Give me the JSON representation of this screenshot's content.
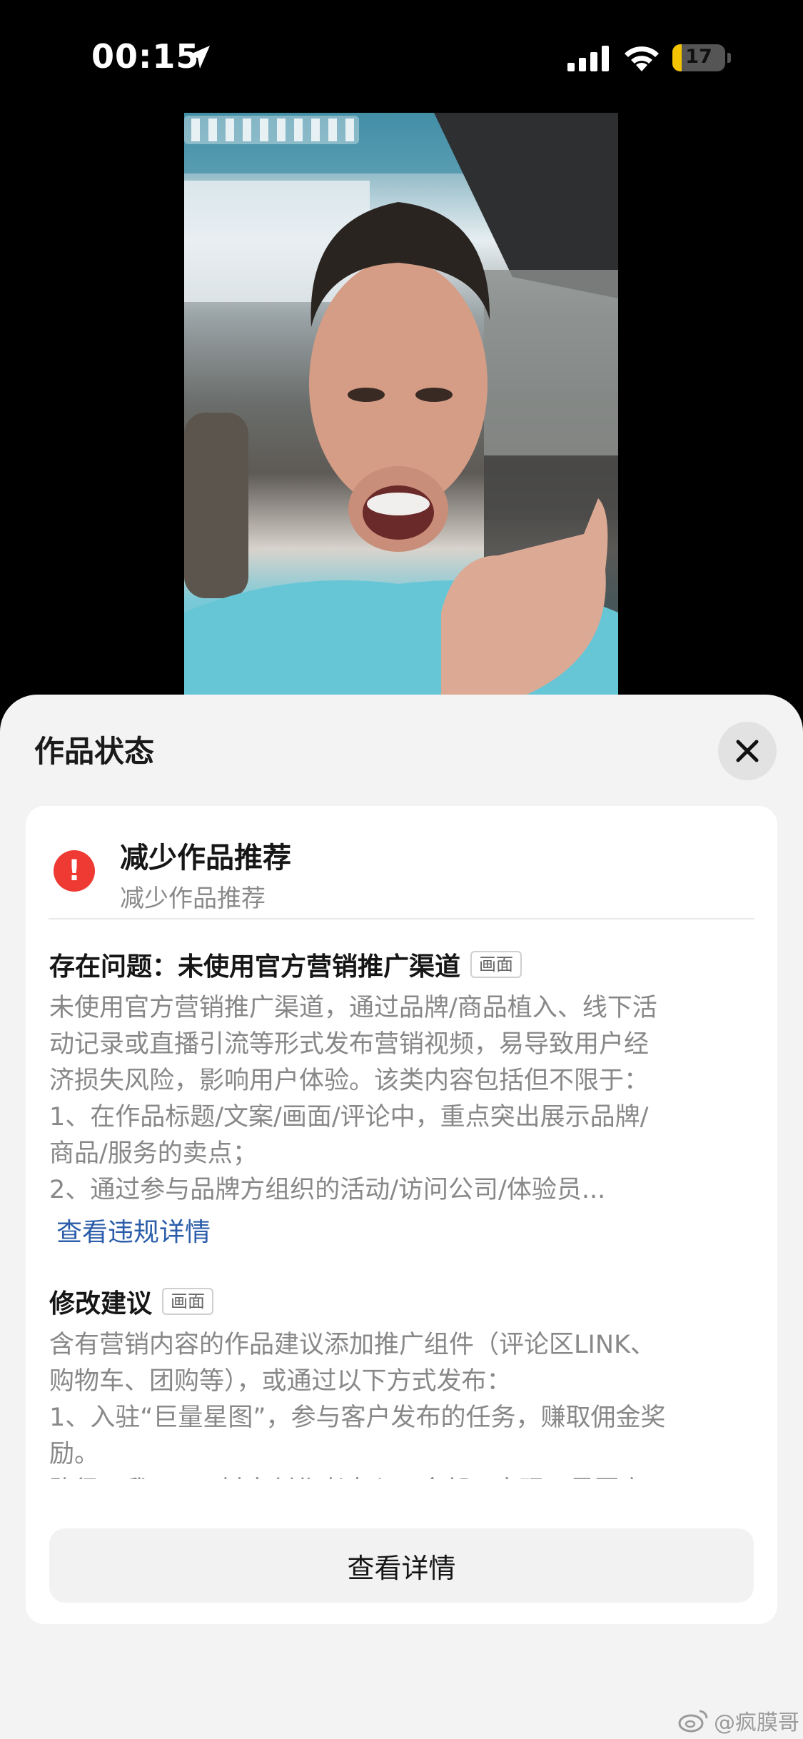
{
  "status_bar": {
    "time": "00:15",
    "battery_level": "17",
    "battery_fill_fraction": 0.17,
    "icons": [
      "location-arrow-icon",
      "cellular-signal-icon",
      "wifi-icon",
      "battery-icon"
    ]
  },
  "video": {
    "description_icon": "video-thumbnail"
  },
  "sheet": {
    "title": "作品状态",
    "close_icon": "close-icon",
    "status": {
      "icon": "alert-icon",
      "title": "减少作品推荐",
      "subtitle": "减少作品推荐"
    },
    "problem": {
      "heading": "存在问题：未使用官方营销推广渠道",
      "tag": "画面",
      "lines": [
        "未使用官方营销推广渠道，通过品牌/商品植入、线下活",
        "动记录或直播引流等形式发布营销视频，易导致用户经",
        "济损失风险，影响用户体验。该类内容包括但不限于：",
        "1、在作品标题/文案/画面/评论中，重点突出展示品牌/",
        "商品/服务的卖点；",
        "2、通过参与品牌方组织的活动/访问公司/体验员..."
      ],
      "link": "查看违规详情"
    },
    "suggestion": {
      "heading": "修改建议",
      "tag": "画面",
      "lines": [
        "含有营销内容的作品建议添加推广组件（评论区LINK、",
        "购物车、团购等），或通过以下方式发布：",
        "1、入驻“巨量星图”，参与客户发布的任务，赚取佣金奖",
        "励。",
        "路径：我 - ≡ - 抖音创作者中心 - 全部 - 变现 - 星图商"
      ]
    },
    "details_button": "查看详情"
  },
  "watermark": {
    "text": "@疯膜哥",
    "icon": "weibo-icon"
  }
}
